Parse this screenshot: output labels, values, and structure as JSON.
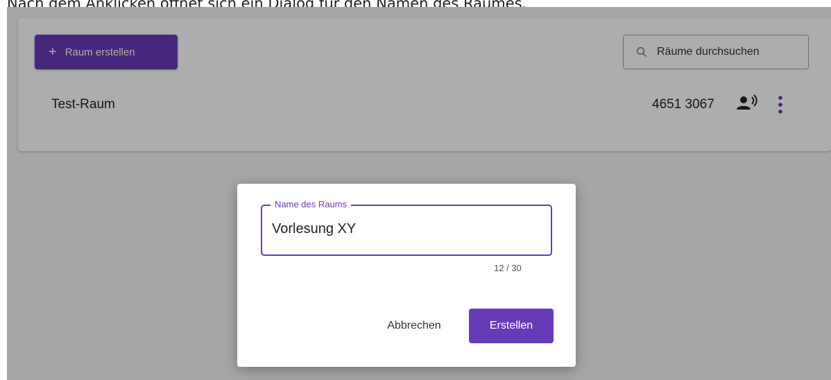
{
  "caption": "Nach dem Anklicken öffnet sich ein Dialog für den Namen des Raumes.",
  "toolbar": {
    "create_label": "Raum erstellen",
    "search_placeholder": "Räume durchsuchen"
  },
  "rooms": [
    {
      "name": "Test-Raum",
      "id": "4651 3067"
    }
  ],
  "dialog": {
    "field_label": "Name des Raums",
    "field_value": "Vorlesung XY",
    "counter": "12 / 30",
    "cancel_label": "Abbrechen",
    "submit_label": "Erstellen"
  },
  "icons": {
    "create": "plus-icon",
    "search": "search-icon",
    "voice": "record-voice-icon",
    "more": "more-vert-icon"
  },
  "colors": {
    "accent": "#673ab7",
    "scrim": "rgba(0,0,0,0.32)"
  }
}
